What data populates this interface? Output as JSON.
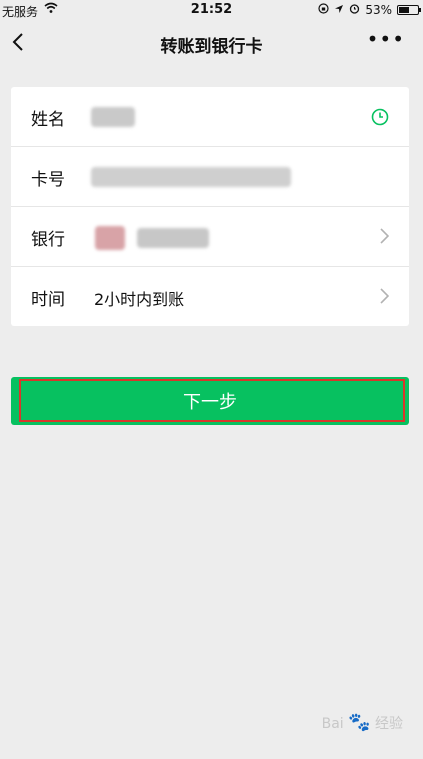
{
  "status_bar": {
    "carrier": "无服务",
    "time": "21:52",
    "battery": "53%",
    "battery_level": 0.53
  },
  "nav": {
    "title": "转账到银行卡",
    "more": "•••"
  },
  "form": {
    "name_label": "姓名",
    "card_label": "卡号",
    "bank_label": "银行",
    "time_label": "时间",
    "time_value": "2小时内到账"
  },
  "next_button": "下一步",
  "watermark": "Bai 经验",
  "colors": {
    "accent": "#07c160",
    "highlight": "#d9362b",
    "clock_icon": "#07c160",
    "background": "#ededed"
  }
}
